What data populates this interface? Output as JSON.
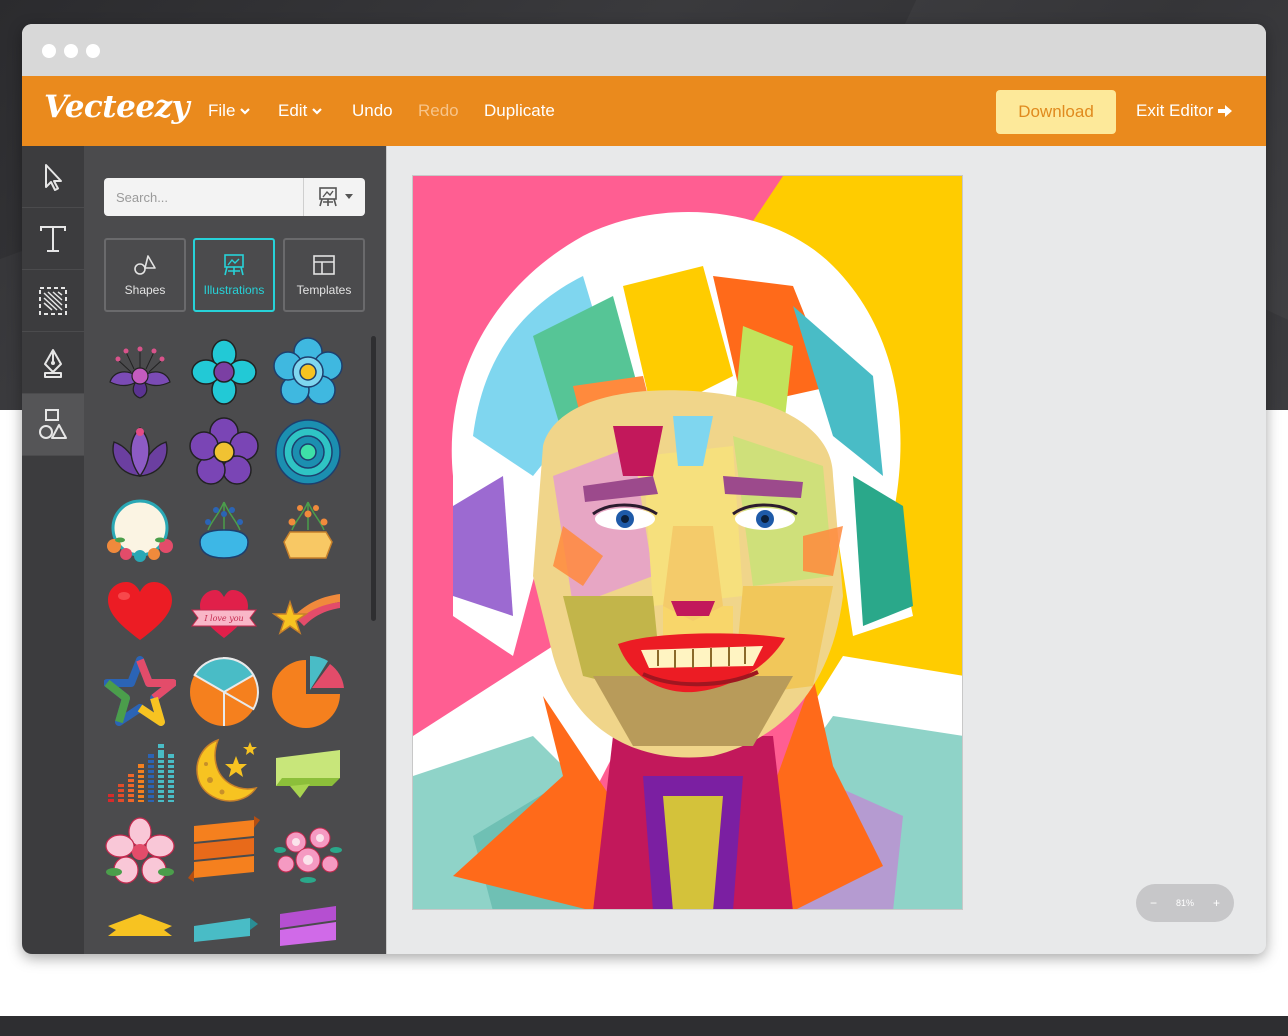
{
  "app": {
    "logo": "Vecteezy"
  },
  "menu": {
    "file": "File",
    "edit": "Edit",
    "undo": "Undo",
    "redo": "Redo",
    "duplicate": "Duplicate",
    "download": "Download",
    "exit": "Exit Editor"
  },
  "tools": [
    {
      "name": "select-tool",
      "icon": "cursor-icon"
    },
    {
      "name": "text-tool",
      "icon": "text-icon"
    },
    {
      "name": "image-tool",
      "icon": "image-icon"
    },
    {
      "name": "pen-tool",
      "icon": "pen-icon"
    },
    {
      "name": "shapes-tool",
      "icon": "shapes-icon",
      "active": true
    }
  ],
  "panel": {
    "search_placeholder": "Search...",
    "tabs": [
      {
        "label": "Shapes",
        "icon": "shapes-icon"
      },
      {
        "label": "Illustrations",
        "icon": "illustration-icon",
        "active": true
      },
      {
        "label": "Templates",
        "icon": "template-icon"
      }
    ],
    "assets": [
      "purple-flower-1",
      "cyan-flower-1",
      "cyan-flower-2",
      "purple-lotus",
      "purple-flower-2",
      "teal-flower",
      "floral-circle-frame",
      "floral-blue-label",
      "floral-yellow-label",
      "red-heart",
      "i-love-you-heart",
      "shooting-star",
      "rainbow-star",
      "pie-chart-1",
      "pie-chart-2",
      "equalizer-bars",
      "moon-stars",
      "ribbon-banner",
      "pink-hibiscus",
      "orange-ribbon",
      "pink-flowers",
      "yellow-banner",
      "teal-ribbon",
      "purple-ribbon"
    ]
  },
  "zoom": {
    "minus": "−",
    "level": "81%",
    "plus": "+"
  },
  "colors": {
    "brand_orange": "#ea8a1d",
    "download_bg": "#fde99a",
    "active_tab": "#27d2d8"
  }
}
